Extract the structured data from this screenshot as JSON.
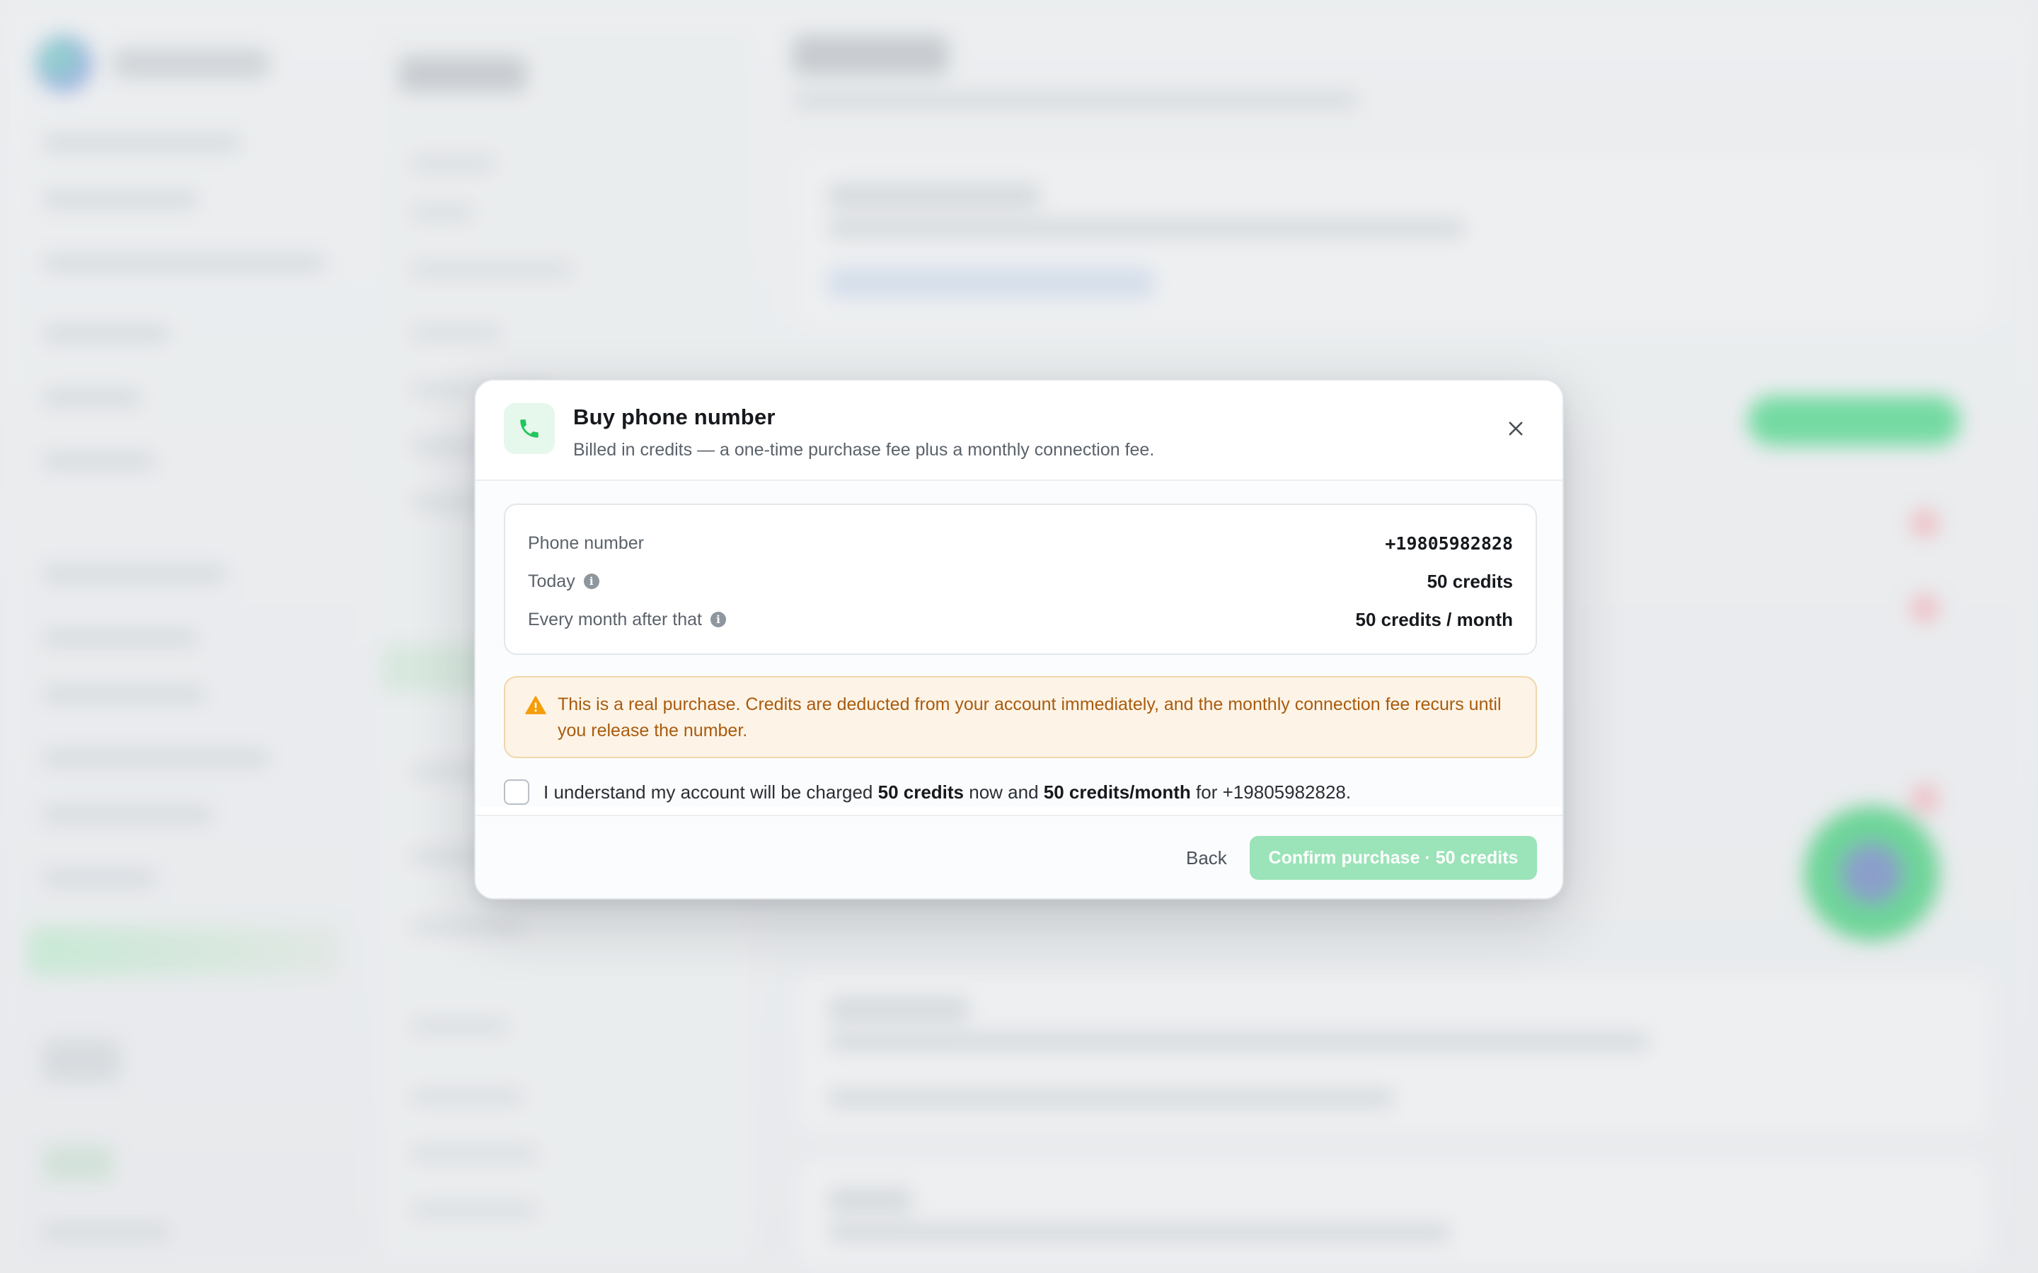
{
  "modal": {
    "title": "Buy phone number",
    "subtitle": "Billed in credits — a one-time purchase fee plus a monthly connection fee.",
    "icon": "phone-icon",
    "close_icon": "close-icon"
  },
  "summary": {
    "rows": [
      {
        "label": "Phone number",
        "value": "+19805982828",
        "info": false
      },
      {
        "label": "Today",
        "value": "50 credits",
        "info": true
      },
      {
        "label": "Every month after that",
        "value": "50 credits / month",
        "info": true
      }
    ],
    "info_glyph": "i"
  },
  "warning": {
    "icon": "warning-icon",
    "text": "This is a real purchase. Credits are deducted from your account immediately, and the monthly connection fee recurs until you release the number."
  },
  "consent": {
    "checked": false,
    "prefix": "I understand my account will be charged ",
    "amount_now": "50 credits",
    "middle": " now and ",
    "amount_monthly": "50 credits/month",
    "middle2": " for ",
    "number": "+19805982828",
    "suffix": "."
  },
  "footer": {
    "back_label": "Back",
    "confirm_label": "Confirm purchase · 50 credits"
  },
  "colors": {
    "accent": "#22c55e",
    "confirm_disabled": "#9be3b8",
    "warning_text": "#a95b0e",
    "warning_bg": "#fdf4e7"
  }
}
